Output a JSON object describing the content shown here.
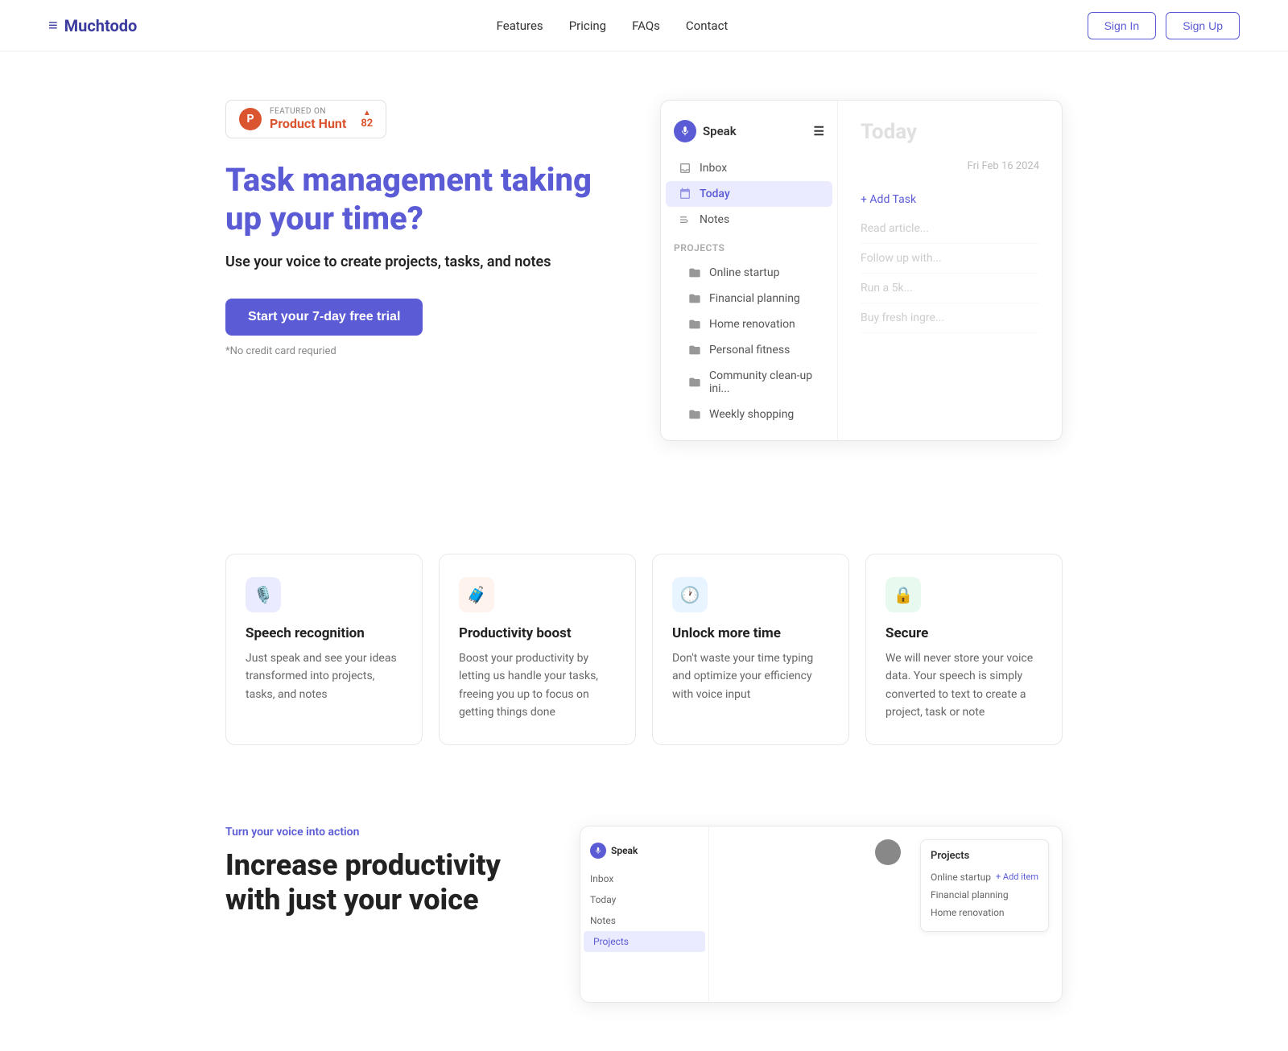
{
  "brand": {
    "name": "Muchtodo",
    "logo_icon": "≡"
  },
  "nav": {
    "links": [
      "Features",
      "Pricing",
      "FAQs",
      "Contact"
    ],
    "sign_in": "Sign In",
    "sign_up": "Sign Up"
  },
  "product_hunt": {
    "featured_text": "FEATURED ON",
    "name": "Product Hunt",
    "arrow": "▲",
    "votes": "82"
  },
  "hero": {
    "headline": "Task management taking up your time?",
    "subtext": "Use your voice to create projects, tasks, and notes",
    "cta": "Start your 7-day free trial",
    "no_cc": "*No credit card requried"
  },
  "app_preview": {
    "header_label": "Speak",
    "menu_icon": "☰",
    "sidebar_items": [
      {
        "icon": "inbox",
        "label": "Inbox",
        "active": false
      },
      {
        "icon": "today",
        "label": "Today",
        "active": true
      },
      {
        "icon": "notes",
        "label": "Notes",
        "active": false
      }
    ],
    "projects_label": "Projects",
    "projects": [
      "Online startup",
      "Financial planning",
      "Home renovation",
      "Personal fitness",
      "Community clean-up ini...",
      "Weekly shopping"
    ],
    "main_title": "Today",
    "main_date": "Fri Feb 16 2024",
    "add_task": "+ Add Task",
    "tasks": [
      "Read article...",
      "Follow up with...",
      "Run a 5k...",
      "Buy fresh ingre..."
    ]
  },
  "features": [
    {
      "icon": "🎙️",
      "icon_color": "purple",
      "title": "Speech recognition",
      "desc": "Just speak and see your ideas transformed into projects, tasks, and notes"
    },
    {
      "icon": "🧳",
      "icon_color": "orange",
      "title": "Productivity boost",
      "desc": "Boost your productivity by letting us handle your tasks, freeing you up to focus on getting things done"
    },
    {
      "icon": "🕐",
      "icon_color": "blue",
      "title": "Unlock more time",
      "desc": "Don't waste your time typing and optimize your efficiency with voice input"
    },
    {
      "icon": "🔒",
      "icon_color": "green",
      "title": "Secure",
      "desc": "We will never store your voice data. Your speech is simply converted to text to create a project, task or note"
    }
  ],
  "bottom": {
    "tag": "Turn your voice into action",
    "headline": "Increase productivity with just your voice"
  },
  "app2_preview": {
    "header": "Speak",
    "sidebar_items": [
      "Inbox",
      "Today",
      "Notes",
      "Projects"
    ],
    "active_item": "Projects",
    "projects_panel_title": "Projects",
    "add_btn": "+ Add item",
    "projects": [
      {
        "name": "Online startup",
        "count": ""
      },
      {
        "name": "Financial planning",
        "count": ""
      },
      {
        "name": "Home renovation",
        "count": ""
      }
    ]
  }
}
